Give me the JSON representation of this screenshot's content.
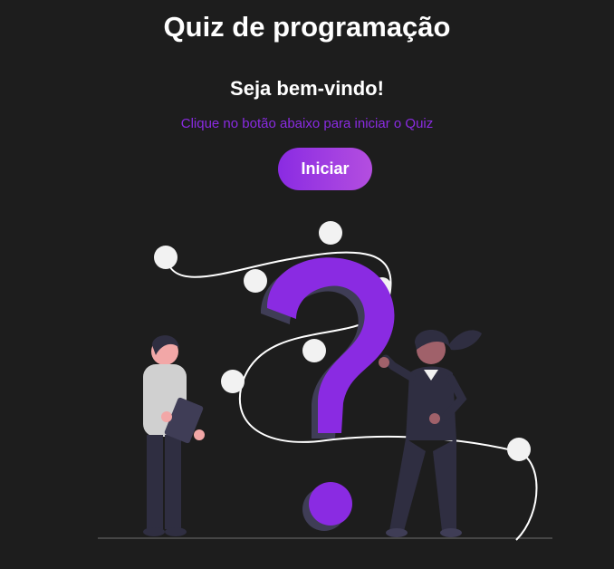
{
  "header": {
    "title": "Quiz de programação",
    "welcome": "Seja bem-vindo!",
    "instructions": "Clique no botão abaixo para iniciar o Quiz"
  },
  "actions": {
    "start_label": "Iniciar"
  },
  "illustration": {
    "icon": "question-people-illustration",
    "accent_color": "#8a2be2"
  },
  "colors": {
    "background": "#1d1d1d",
    "accent": "#8a2be2",
    "button_gradient_end": "#b44ee0",
    "text": "#ffffff"
  }
}
